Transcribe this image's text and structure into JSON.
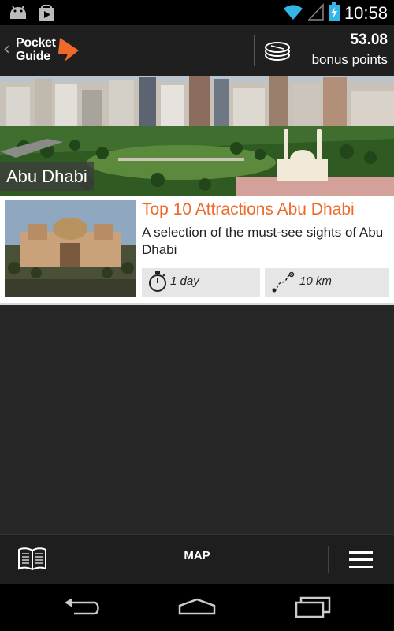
{
  "status_bar": {
    "time": "10:58",
    "icons": [
      "android-icon",
      "play-store-icon",
      "wifi-icon",
      "signal-icon",
      "battery-charging-icon"
    ]
  },
  "app_bar": {
    "logo_line1": "Pocket",
    "logo_line2": "Guide",
    "points_value": "53.08",
    "points_label": "bonus points",
    "accent_color": "#ef6a2a"
  },
  "hero": {
    "city": "Abu Dhabi"
  },
  "tour_card": {
    "title": "Top 10 Attractions Abu Dhabi",
    "description": "A selection of the must-see sights of Abu Dhabi",
    "duration": "1 day",
    "distance": "10 km"
  },
  "bottom_bar": {
    "map_label": "MAP"
  }
}
